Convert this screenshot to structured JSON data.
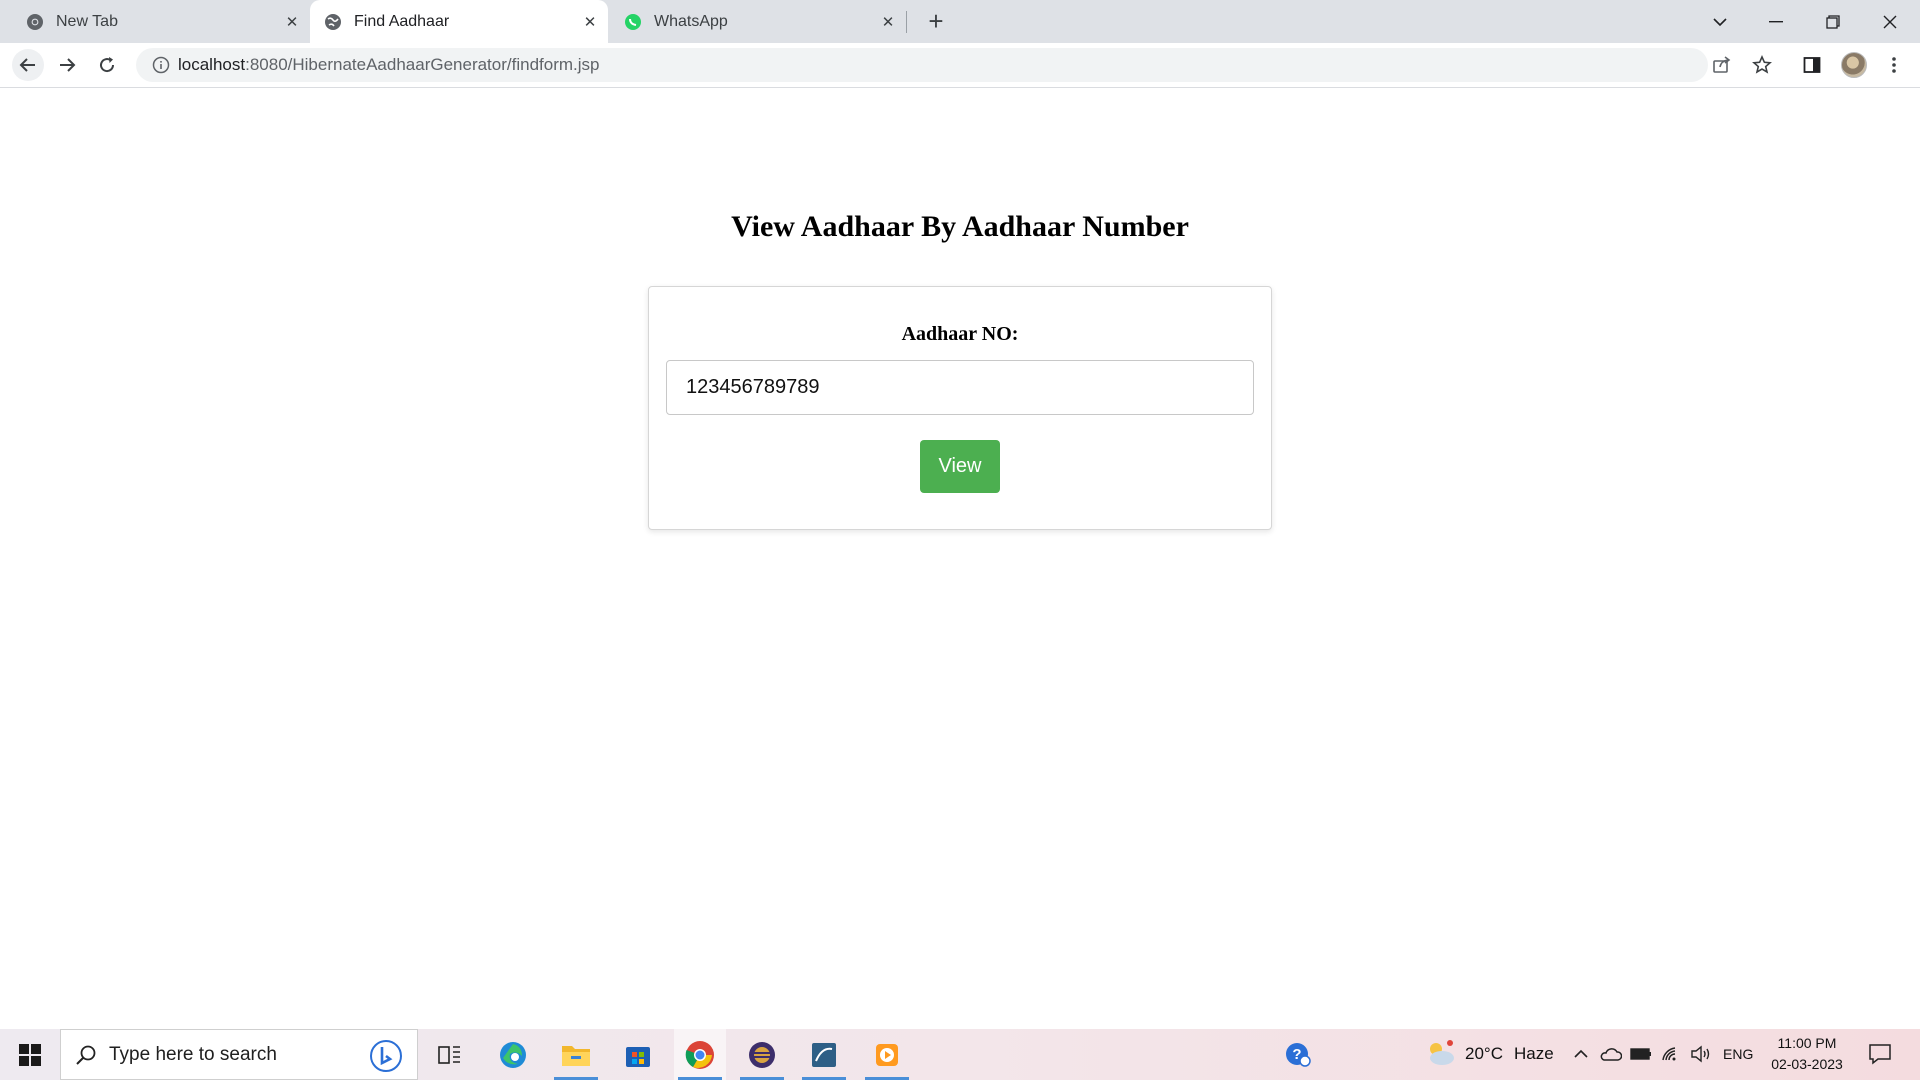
{
  "browser": {
    "tabs": [
      {
        "title": "New Tab",
        "favicon": "chrome-icon",
        "active": false
      },
      {
        "title": "Find Aadhaar",
        "favicon": "globe-icon",
        "active": true
      },
      {
        "title": "WhatsApp",
        "favicon": "whatsapp-icon",
        "active": false
      }
    ],
    "url_host": "localhost",
    "url_rest": ":8080/HibernateAadhaarGenerator/findform.jsp"
  },
  "page": {
    "title": "View Aadhaar By Aadhaar Number",
    "form": {
      "label": "Aadhaar NO:",
      "input_value": "123456789789",
      "button_label": "View"
    }
  },
  "taskbar": {
    "search_placeholder": "Type here to search",
    "weather_temp": "20°C",
    "weather_desc": "Haze",
    "language": "ENG",
    "time": "11:00 PM",
    "date": "02-03-2023"
  },
  "colors": {
    "accent_button": "#4caf50",
    "tabstrip": "#dee1e6"
  }
}
